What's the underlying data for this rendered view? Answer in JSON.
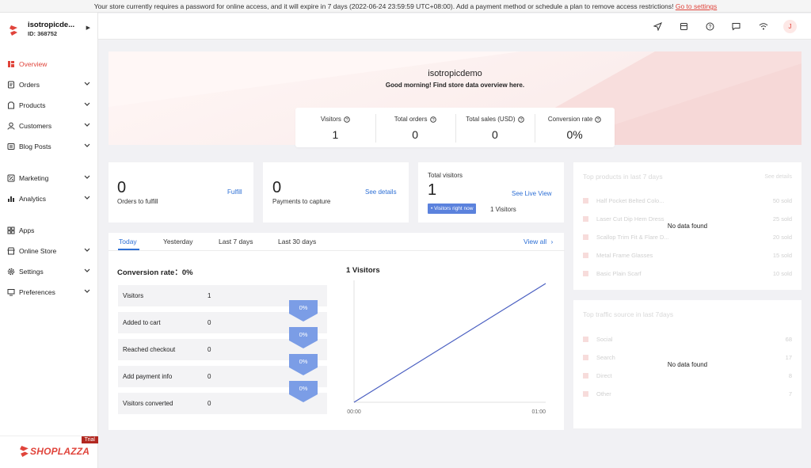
{
  "banner": {
    "text": "Your store currently requires a password for online access, and it will expire in 7 days (2022-06-24 23:59:59 UTC+08:00). Add a payment method or schedule a plan to remove access restrictions!",
    "link": "Go to settings"
  },
  "store": {
    "name": "isotropicde...",
    "id": "ID: 368752"
  },
  "nav": {
    "overview": "Overview",
    "orders": "Orders",
    "products": "Products",
    "customers": "Customers",
    "blog_posts": "Blog Posts",
    "marketing": "Marketing",
    "analytics": "Analytics",
    "apps": "Apps",
    "online_store": "Online Store",
    "settings": "Settings",
    "preferences": "Preferences"
  },
  "brand": {
    "name": "SHOPLAZZA",
    "badge": "Trial"
  },
  "user": {
    "initial": "J"
  },
  "hero": {
    "store_name": "isotropicdemo",
    "greeting": "Good morning! Find store data overview here."
  },
  "stats": [
    {
      "label": "Visitors",
      "value": "1"
    },
    {
      "label": "Total orders",
      "value": "0"
    },
    {
      "label": "Total sales (USD)",
      "value": "0"
    },
    {
      "label": "Conversion rate",
      "value": "0%"
    }
  ],
  "fulfill": {
    "value": "0",
    "label": "Orders to fulfill",
    "link": "Fulfill"
  },
  "capture": {
    "value": "0",
    "label": "Payments to capture",
    "link": "See details"
  },
  "visitors_card": {
    "title": "Total visitors",
    "value": "1",
    "link": "See Live View",
    "badge": "• Visitors right now",
    "now": "1 Visitors"
  },
  "tabs": [
    "Today",
    "Yesterday",
    "Last 7 days",
    "Last 30 days"
  ],
  "view_all": "View all",
  "conversion": {
    "title": "Conversion rate：0%",
    "rows": [
      {
        "label": "Visitors",
        "value": "1"
      },
      {
        "label": "Added to cart",
        "value": "0"
      },
      {
        "label": "Reached checkout",
        "value": "0"
      },
      {
        "label": "Add payment info",
        "value": "0"
      },
      {
        "label": "Visitors converted",
        "value": "0"
      }
    ],
    "percents": [
      "0%",
      "0%",
      "0%",
      "0%"
    ]
  },
  "chart_data": {
    "type": "line",
    "title": "1 Visitors",
    "x": [
      "00:00",
      "01:00"
    ],
    "series": [
      {
        "values": [
          0,
          1
        ]
      }
    ],
    "color": "#4a5fc1"
  },
  "top_products": {
    "title": "Top products in last 7 days",
    "see_all": "See details",
    "items": [
      {
        "name": "Half Pocket Belted Colo...",
        "value": "50 sold"
      },
      {
        "name": "Laser Cut Dip Hem Dress",
        "value": "25 sold"
      },
      {
        "name": "Scallop Trim Fit & Flare D...",
        "value": "20 sold"
      },
      {
        "name": "Metal Frame Glasses",
        "value": "15 sold"
      },
      {
        "name": "Basic Plain Scarf",
        "value": "10 sold"
      }
    ],
    "empty": "No data found"
  },
  "traffic": {
    "title": "Top traffic source in last 7days",
    "items": [
      {
        "name": "Social",
        "value": "68"
      },
      {
        "name": "Search",
        "value": "17"
      },
      {
        "name": "Direct",
        "value": "8"
      },
      {
        "name": "Other",
        "value": "7"
      }
    ],
    "empty": "No data found"
  },
  "colors": {
    "accent": "#e0443b",
    "link": "#2d6fd5",
    "funnel": "#7b9de6"
  }
}
